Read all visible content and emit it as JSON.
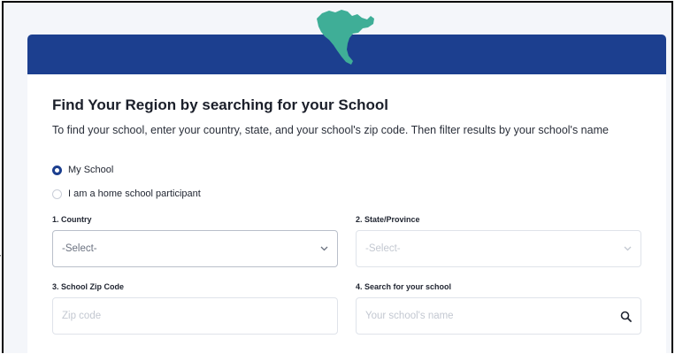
{
  "form": {
    "title": "Find Your Region by searching for your School",
    "subtitle": "To find your school, enter your country, state, and your school's zip code. Then filter results by your school's name",
    "radio_options": [
      {
        "label": "My School",
        "selected": true
      },
      {
        "label": "I am a home school participant",
        "selected": false
      }
    ],
    "country": {
      "label": "1. Country",
      "value": "-Select-"
    },
    "state": {
      "label": "2. State/Province",
      "value": "-Select-"
    },
    "zip": {
      "label": "3. School Zip Code",
      "placeholder": "Zip code"
    },
    "school": {
      "label": "4. Search for your school",
      "placeholder": "Your school's name"
    }
  },
  "icons": {
    "logo": "north-america-map-icon",
    "select_arrow": "chevron-down-icon",
    "search": "search-icon"
  },
  "colors": {
    "banner": "#1c3f8f",
    "logo": "#3fae97",
    "radio_selected": "#1c3f8f",
    "page_background": "#f4f6fa"
  }
}
